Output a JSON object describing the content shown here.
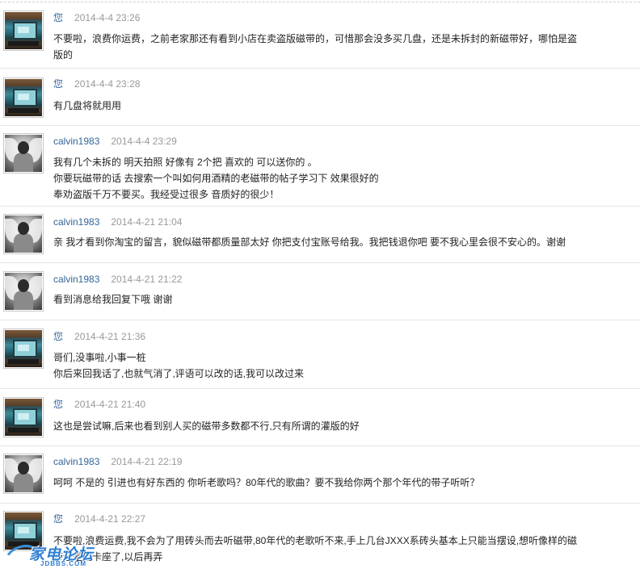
{
  "comments": [
    {
      "author": "您",
      "avatar": "tv-console-avatar",
      "time": "2014-4-4 23:26",
      "lines": [
        "不要啦，浪费你运费，之前老家那还有看到小店在卖盗版磁带的，可惜那会没多买几盘，还是未拆封的新磁带好，哪怕是盗",
        "版的"
      ]
    },
    {
      "author": "您",
      "avatar": "tv-console-avatar",
      "time": "2014-4-4 23:28",
      "lines": [
        "有几盘将就用用"
      ]
    },
    {
      "author": "calvin1983",
      "avatar": "winged-man-avatar",
      "time": "2014-4-4 23:29",
      "lines": [
        "我有几个未拆的 明天拍照 好像有 2个把 喜欢的 可以送你的 。",
        "你要玩磁带的话 去搜索一个叫如何用酒精的老磁带的帖子学习下 效果很好的",
        "奉劝盗版千万不要买。我经受过很多 音质好的很少！"
      ]
    },
    {
      "author": "calvin1983",
      "avatar": "winged-man-avatar",
      "time": "2014-4-21 21:04",
      "lines": [
        "亲 我才看到你淘宝的留言，貌似磁带都质量部太好 你把支付宝账号给我。我把钱退你吧 要不我心里会很不安心的。谢谢"
      ]
    },
    {
      "author": "calvin1983",
      "avatar": "winged-man-avatar",
      "time": "2014-4-21 21:22",
      "lines": [
        "看到消息给我回复下哦 谢谢"
      ]
    },
    {
      "author": "您",
      "avatar": "tv-console-avatar",
      "time": "2014-4-21 21:36",
      "lines": [
        "哥们,没事啦,小事一桩",
        "你后来回我话了,也就气消了,评语可以改的话,我可以改过来"
      ]
    },
    {
      "author": "您",
      "avatar": "tv-console-avatar",
      "time": "2014-4-21 21:40",
      "lines": [
        "这也是尝试嘛,后来也看到别人买的磁带多数都不行,只有所谓的灌版的好"
      ]
    },
    {
      "author": "calvin1983",
      "avatar": "winged-man-avatar",
      "time": "2014-4-21 22:19",
      "lines": [
        "呵呵 不是的 引进也有好东西的 你听老歌吗？80年代的歌曲？要不我给你两个那个年代的带子听听？"
      ]
    },
    {
      "author": "您",
      "avatar": "tv-console-avatar",
      "time": "2014-4-21 22:27",
      "lines": [
        "不要啦,浪费运费,我不会为了用砖头而去听磁带,80年代的老歌听不来,手上几台JXXX系砖头基本上只能当摆设,想听像样的磁",
        "带还是用卡座了,以后再弄"
      ]
    }
  ],
  "watermark": {
    "brand": "家电论坛",
    "domain": "JDBBS.COM"
  }
}
